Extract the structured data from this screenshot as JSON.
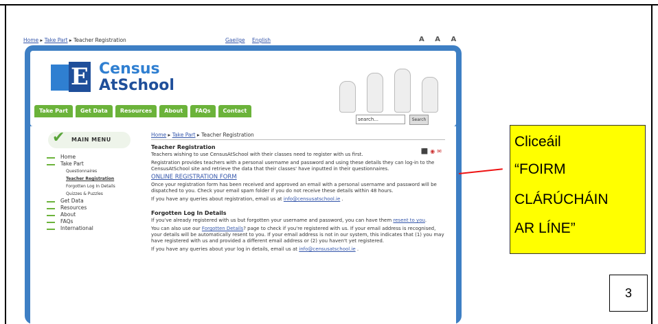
{
  "site": {
    "topbar": {
      "breadcrumb": [
        "Home",
        "Take Part",
        "Teacher Registration"
      ],
      "lang_irish": "Gaeilge",
      "lang_english": "English",
      "font_size_controls": "A A A"
    },
    "logo": {
      "line1": "Census",
      "line2": "AtSchool"
    },
    "nav": [
      "Take Part",
      "Get Data",
      "Resources",
      "About",
      "FAQs",
      "Contact"
    ],
    "search": {
      "placeholder": "search...",
      "button": "Search"
    },
    "menu": {
      "title": "MAIN MENU",
      "items": [
        {
          "label": "Home",
          "level": 1
        },
        {
          "label": "Take Part",
          "level": 1
        },
        {
          "label": "Questionnaires",
          "level": 2
        },
        {
          "label": "Teacher Registration",
          "level": 2,
          "active": true
        },
        {
          "label": "Forgotten Log In Details",
          "level": 2
        },
        {
          "label": "Quizzes & Puzzles",
          "level": 2
        },
        {
          "label": "Get Data",
          "level": 1
        },
        {
          "label": "Resources",
          "level": 1
        },
        {
          "label": "About",
          "level": 1
        },
        {
          "label": "FAQs",
          "level": 1
        },
        {
          "label": "International",
          "level": 1
        }
      ]
    },
    "main": {
      "breadcrumb": [
        "Home",
        "Take Part",
        "Teacher Registration"
      ],
      "heading": "Teacher Registration",
      "p1": "Teachers wishing to use CensusAtSchool with their classes need to register with us first.",
      "p2": "Registration provides teachers with a personal username and password and using these details they can log-in to the CensusAtSchool site and retrieve the data that their classes' have inputted in their questionnaires.",
      "form_link": "ONLINE REGISTRATION FORM",
      "p3": "Once your registration form has been received and approved an email with a personal username and password will be dispatched to you. Check your email spam folder if you do not receive these details within 48 hours.",
      "p4_prefix": "If you have any queries about registration, email us at ",
      "email": "info@censusatschool.ie",
      "p4_suffix": " .",
      "heading2": "Forgotten Log In Details",
      "p5_prefix": "If you've already registered with us but forgotten your username and password, you can have them ",
      "p5_link": "resent to you",
      "p5_suffix": ".",
      "p6_prefix": "You can also use our ",
      "p6_link": "Forgotten Details",
      "p6_suffix": "? page to check if you're registered with us. If your email address is recognised, your details will be automatically resent to you. If your email address is not in our system, this indicates that (1) you may have registered with us and provided a different email address or (2) you haven't yet registered.",
      "p7_prefix": "If you have any queries about your log in details, email us at ",
      "p7_email": "info@censusatschool.ie",
      "p7_suffix": " ."
    }
  },
  "callout": {
    "lines": [
      "Cliceáil",
      "“FOIRM",
      "CLÁRÚCHÁIN",
      "AR LÍNE”"
    ]
  },
  "page_number": "3",
  "colors": {
    "site_blue": "#3e7fc4",
    "nav_green": "#6bb33a",
    "callout_yellow": "#ffff00",
    "pointer_red": "#ee1111"
  }
}
